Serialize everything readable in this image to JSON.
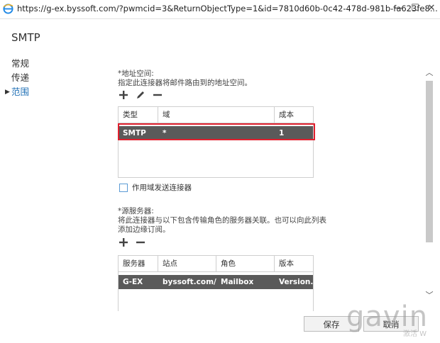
{
  "browser": {
    "url": "https://g-ex.byssoft.com/?pwmcid=3&ReturnObjectType=1&id=7810d60b-0c42-478d-981b-fa623fe8...",
    "minimize": "—",
    "maximize": "☐",
    "close": "✕"
  },
  "page": {
    "title": "SMTP"
  },
  "nav": {
    "items": [
      {
        "label": "常规"
      },
      {
        "label": "传递"
      },
      {
        "label": "范围",
        "active": true
      }
    ]
  },
  "address_space": {
    "label": "*地址空间:",
    "description": "指定此连接器将邮件路由到的地址空间。",
    "columns": [
      "类型",
      "域",
      "成本"
    ],
    "rows": [
      {
        "type": "SMTP",
        "domain": "*",
        "cost": "1"
      }
    ]
  },
  "scope": {
    "checkbox_label": "作用域发送连接器",
    "checked": false
  },
  "source_servers": {
    "label": "*源服务器:",
    "description_line1": "将此连接器与以下包含传输角色的服务器关联。也可以向此列表",
    "description_line2": "添加边缘订阅。",
    "columns": [
      "服务器",
      "站点",
      "角色",
      "版本"
    ],
    "rows": [
      {
        "server": "G-EX",
        "site": "byssoft.com/...",
        "role": "Mailbox",
        "version": "Version..."
      }
    ]
  },
  "buttons": {
    "save": "保存",
    "cancel": "取消"
  },
  "watermark": {
    "main": "gavin",
    "sub": "激活 W"
  },
  "colors": {
    "selected_row": "#5a5a5a",
    "highlight_border": "#e0202e",
    "active_nav": "#1f6fb5"
  }
}
